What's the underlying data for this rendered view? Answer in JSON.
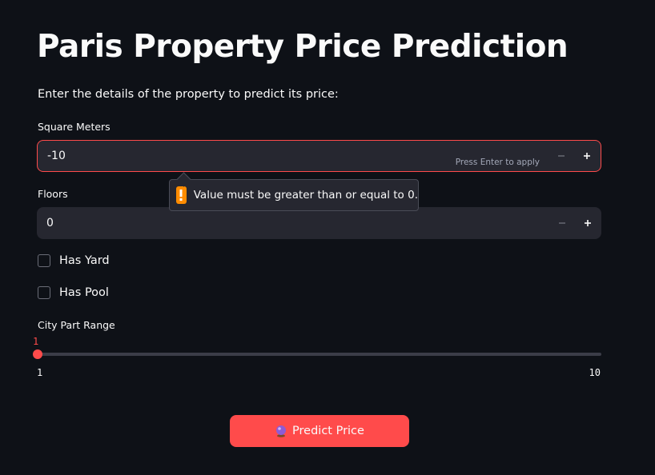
{
  "page": {
    "title": "Paris Property Price Prediction",
    "subtitle": "Enter the details of the property to predict its price:"
  },
  "square_meters": {
    "label": "Square Meters",
    "value": "-10",
    "hint": "Press Enter to apply",
    "error_tooltip": "Value must be greater than or equal to 0.",
    "error_icon": "exclamation-icon"
  },
  "floors": {
    "label": "Floors",
    "value": "0"
  },
  "has_yard": {
    "label": "Has Yard",
    "checked": false
  },
  "has_pool": {
    "label": "Has Pool",
    "checked": false
  },
  "city_part_range": {
    "label": "City Part Range",
    "value": "1",
    "min": "1",
    "max": "10"
  },
  "predict_button": {
    "label": "Predict Price",
    "icon": "crystal-ball-icon"
  },
  "colors": {
    "background": "#0e1117",
    "accent": "#ff4b4b",
    "input_bg": "#262730",
    "warning": "#ff8c00"
  }
}
